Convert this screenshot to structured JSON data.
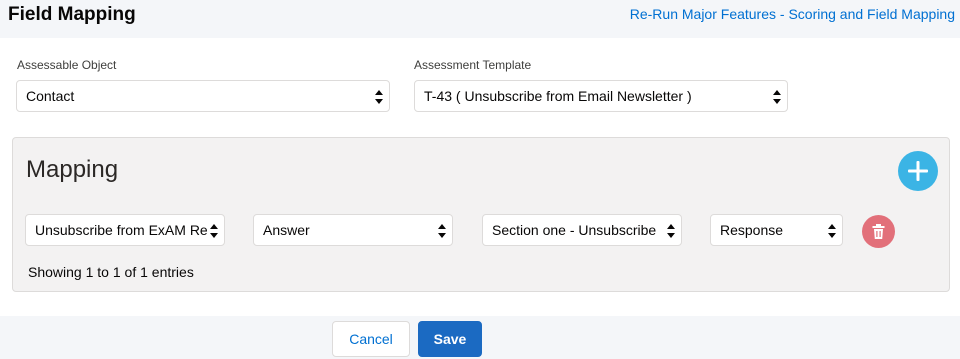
{
  "header": {
    "title": "Field Mapping",
    "link": "Re-Run Major Features - Scoring and Field Mapping"
  },
  "form": {
    "assessable_object": {
      "label": "Assessable Object",
      "value": "Contact"
    },
    "assessment_template": {
      "label": "Assessment Template",
      "value": "T-43 ( Unsubscribe from Email Newsletter )"
    }
  },
  "mapping": {
    "title": "Mapping",
    "row": {
      "question": "Unsubscribe from ExAM Re",
      "answer": "Answer",
      "section": "Section one - Unsubscribe",
      "response": "Response"
    },
    "entries_parts": [
      "Showing ",
      "1",
      " to ",
      "1",
      " of ",
      "1",
      " entries"
    ]
  },
  "footer": {
    "cancel_label": "Cancel",
    "save_label": "Save"
  },
  "colors": {
    "add_button": "#3bb4e5",
    "delete_button": "#e2707a",
    "save_button": "#1b6ac2",
    "link": "#0070d2"
  },
  "icons": [
    "plus-icon",
    "trash-icon",
    "sort-arrows-icon"
  ]
}
